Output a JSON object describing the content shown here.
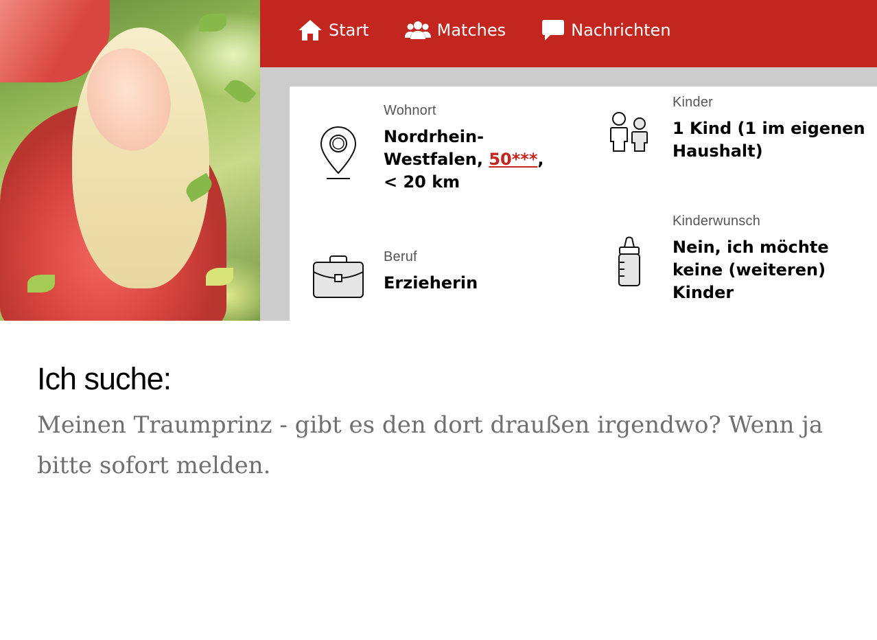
{
  "nav": {
    "items": [
      {
        "label": "Start",
        "icon": "home-icon"
      },
      {
        "label": "Matches",
        "icon": "users-icon"
      },
      {
        "label": "Nachrichten",
        "icon": "chat-bubble-icon"
      }
    ],
    "background": "#c2261e"
  },
  "profile": {
    "photo_alt": "Profilfoto",
    "wohnort": {
      "label": "Wohnort",
      "value_prefix": "Nordrhein-Westfalen, ",
      "plz": "50***",
      "value_suffix": ",",
      "distance": "< 20 km",
      "icon": "location-pin-icon"
    },
    "kinder": {
      "label": "Kinder",
      "value": "1 Kind (1 im eigenen Haushalt)",
      "icon": "children-icon"
    },
    "beruf": {
      "label": "Beruf",
      "value": "Erzieherin",
      "icon": "briefcase-icon"
    },
    "kinderwunsch": {
      "label": "Kinderwunsch",
      "value": "Nein, ich möchte keine (weiteren) Kinder",
      "icon": "baby-bottle-icon"
    }
  },
  "search": {
    "heading": "Ich suche:",
    "text": "Meinen Traumprinz - gibt es den dort draußen irgendwo? Wenn ja bitte sofort melden."
  },
  "colors": {
    "accent": "#c2261e",
    "grey": "#cccccc",
    "body_text": "#6f6f6f"
  }
}
